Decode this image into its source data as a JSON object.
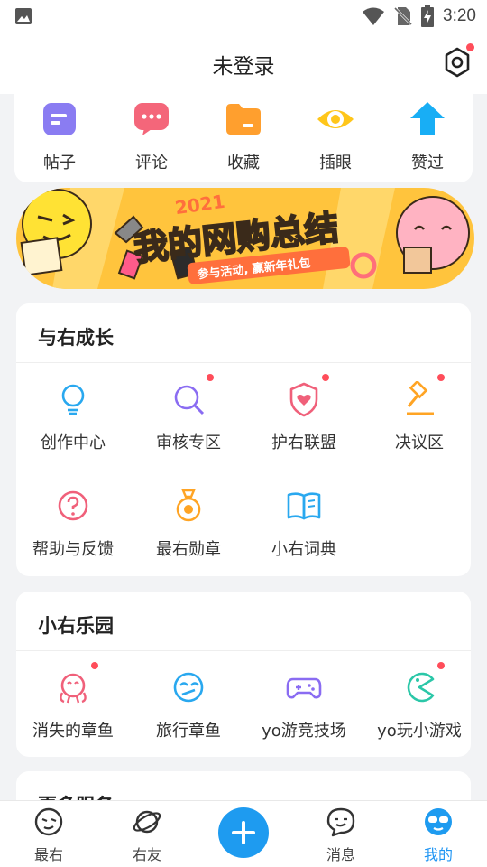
{
  "status_bar": {
    "time": "3:20"
  },
  "header": {
    "title": "未登录"
  },
  "quick_actions": [
    {
      "label": "帖子",
      "icon": "post-icon"
    },
    {
      "label": "评论",
      "icon": "comment-icon"
    },
    {
      "label": "收藏",
      "icon": "folder-icon"
    },
    {
      "label": "插眼",
      "icon": "eye-icon"
    },
    {
      "label": "赞过",
      "icon": "up-arrow-icon"
    }
  ],
  "banner": {
    "year": "2021",
    "headline": "我的网购总结",
    "subline": "参与活动, 赢新年礼包"
  },
  "growth": {
    "title": "与右成长",
    "items": [
      {
        "label": "创作中心",
        "badge": false
      },
      {
        "label": "审核专区",
        "badge": true
      },
      {
        "label": "护右联盟",
        "badge": true
      },
      {
        "label": "决议区",
        "badge": true
      },
      {
        "label": "帮助与反馈",
        "badge": false
      },
      {
        "label": "最右勋章",
        "badge": false
      },
      {
        "label": "小右词典",
        "badge": false
      }
    ]
  },
  "park": {
    "title": "小右乐园",
    "items": [
      {
        "label": "消失的章鱼",
        "badge": true
      },
      {
        "label": "旅行章鱼",
        "badge": false
      },
      {
        "label": "yo游竞技场",
        "badge": false
      },
      {
        "label": "yo玩小游戏",
        "badge": true
      }
    ]
  },
  "more": {
    "title": "更多服务"
  },
  "tabs": [
    {
      "label": "最右"
    },
    {
      "label": "右友"
    },
    {
      "label": "消息"
    },
    {
      "label": "我的"
    }
  ],
  "colors": {
    "accent": "#1e9bf0",
    "badge": "#ff4d5a"
  }
}
